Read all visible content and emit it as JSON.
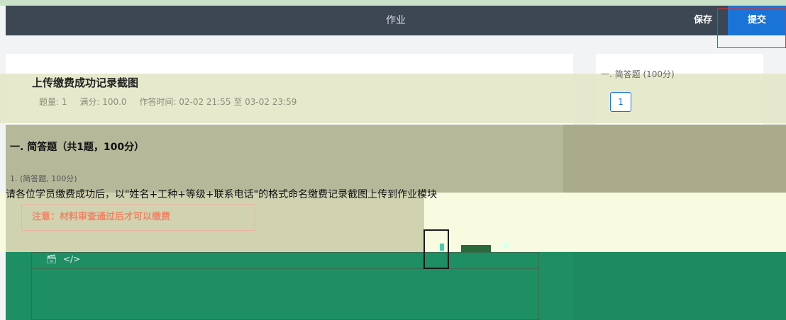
{
  "header": {
    "title": "作业",
    "save_label": "保存",
    "submit_label": "提交",
    "accent_color": "#1a74d8"
  },
  "assignment": {
    "title": "上传缴费成功记录截图",
    "question_count": "题量: 1",
    "full_score": "满分: 100.0",
    "time_range": "作答时间: 02-02 21:55 至 03-02 23:59"
  },
  "section": {
    "title": "一. 简答题（共1题，100分）"
  },
  "question": {
    "meta": "1. (简答题, 100分)",
    "text": "请各位学员缴费成功后，以\"姓名+工种+等级+联系电话\"的格式命名缴费记录截图上传到作业模块",
    "notice": "注意：材料审查通过后才可以缴费"
  },
  "answer_sheet": {
    "title": "一. 简答题 (100分)",
    "items": [
      "1"
    ]
  },
  "editor": {
    "icons": [
      "briefcase-icon",
      "code-icon",
      "image-icon"
    ]
  }
}
